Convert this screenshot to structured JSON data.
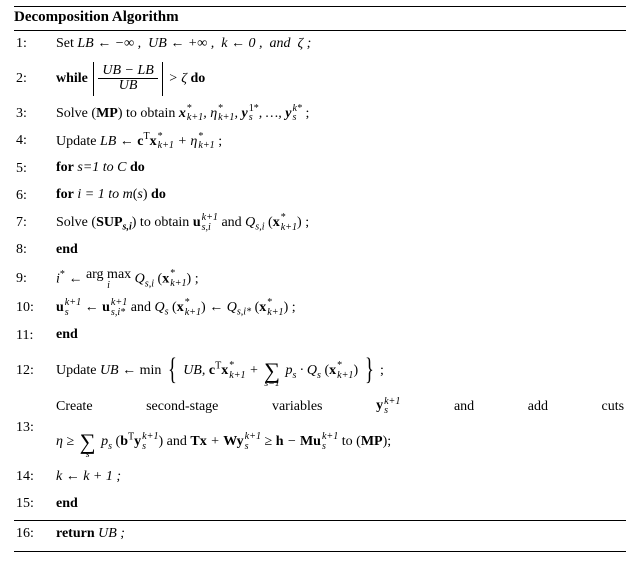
{
  "title": "Decomposition Algorithm",
  "lines": {
    "l1": {
      "num": "1:",
      "pre": "Set ",
      "body": "LB ← −∞ ,  UB ← +∞ ,  k ← 0 ,  and  ζ ;"
    },
    "l2": {
      "num": "2:",
      "pre": "while ",
      "numr": "UB − LB",
      "denr": "UB",
      "post": " > ζ ",
      "do": "do"
    },
    "l3": {
      "num": "3:",
      "pre": "Solve (",
      "mp": "MP",
      "mid": ") to obtain "
    },
    "l4": {
      "num": "4:",
      "pre": "Update "
    },
    "l5": {
      "num": "5:",
      "text": "for",
      "rest": " s=1 to C ",
      "do": "do"
    },
    "l6": {
      "num": "6:",
      "text": "for",
      "rest1": " i = 1 to m",
      "rest2": "s",
      "do": "do"
    },
    "l7": {
      "num": "7:",
      "pre": "Solve (",
      "sup": "SUP",
      "si": "s,i",
      "mid": ") to obtain ",
      "and": " and "
    },
    "l8": {
      "num": "8:",
      "text": "end"
    },
    "l9": {
      "num": "9:"
    },
    "l10": {
      "num": "10:",
      "and": " and "
    },
    "l11": {
      "num": "11:",
      "text": "end"
    },
    "l12": {
      "num": "12:",
      "pre": "Update "
    },
    "l13a": {
      "num": "13:",
      "w1": "Create",
      "w2": "second-stage",
      "w3": "variables",
      "w5": "and",
      "w6": "add",
      "w7": "cuts"
    },
    "l13b": {
      "and": " and ",
      "to": " to (",
      "mp": "MP",
      "end": ");"
    },
    "l14": {
      "num": "14:",
      "text": "k ← k + 1 ;"
    },
    "l15": {
      "num": "15:",
      "text": "end"
    },
    "l16": {
      "num": "16:",
      "text": "return ",
      "ub": "UB ;"
    }
  }
}
